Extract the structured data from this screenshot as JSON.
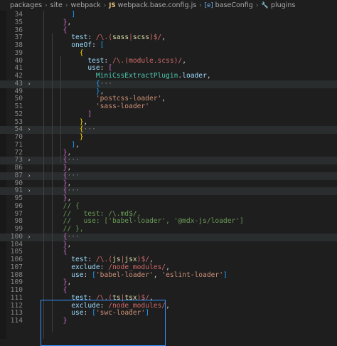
{
  "breadcrumb": {
    "items": [
      "packages",
      "site",
      "webpack",
      "webpack.base.config.js",
      "baseConfig",
      "plugins"
    ],
    "icons": [
      "chevron-right",
      "js-file-icon",
      "symbol-variable-icon",
      "wrench-icon"
    ]
  },
  "editor": {
    "lines": [
      {
        "n": "34",
        "fold": "",
        "segs": [
          [
            "        ",
            ""
          ],
          [
            "]",
            "b3"
          ]
        ]
      },
      {
        "n": "35",
        "fold": "",
        "segs": [
          [
            "      ",
            ""
          ],
          [
            "}",
            "b2"
          ],
          [
            ",",
            ""
          ]
        ]
      },
      {
        "n": "36",
        "fold": "",
        "segs": [
          [
            "      ",
            ""
          ],
          [
            "{",
            "b2"
          ]
        ]
      },
      {
        "n": "37",
        "fold": "",
        "segs": [
          [
            "        ",
            ""
          ],
          [
            "test",
            "k"
          ],
          [
            ": ",
            ""
          ],
          [
            "/\\.(",
            "r"
          ],
          [
            "sass",
            "rc"
          ],
          [
            "|",
            "r"
          ],
          [
            "scss",
            "rc"
          ],
          [
            ")$/",
            "r"
          ],
          [
            ",",
            ""
          ]
        ]
      },
      {
        "n": "38",
        "fold": "",
        "segs": [
          [
            "        ",
            ""
          ],
          [
            "oneOf",
            "k"
          ],
          [
            ": ",
            ""
          ],
          [
            "[",
            "b3"
          ]
        ]
      },
      {
        "n": "39",
        "fold": "",
        "segs": [
          [
            "          ",
            ""
          ],
          [
            "{",
            "b1"
          ]
        ]
      },
      {
        "n": "40",
        "fold": "",
        "segs": [
          [
            "            ",
            ""
          ],
          [
            "test",
            "k"
          ],
          [
            ": ",
            ""
          ],
          [
            "/\\.(module.scss)/",
            "r"
          ],
          [
            ",",
            ""
          ]
        ]
      },
      {
        "n": "41",
        "fold": "",
        "segs": [
          [
            "            ",
            ""
          ],
          [
            "use",
            "k"
          ],
          [
            ": ",
            ""
          ],
          [
            "[",
            "b2"
          ]
        ]
      },
      {
        "n": "42",
        "fold": "",
        "segs": [
          [
            "              ",
            ""
          ],
          [
            "MiniCssExtractPlugin",
            "fn"
          ],
          [
            ".",
            ""
          ],
          [
            "loader",
            "k"
          ],
          [
            ",",
            ""
          ]
        ]
      },
      {
        "n": "43",
        "fold": ">",
        "hl": true,
        "segs": [
          [
            "              ",
            ""
          ],
          [
            "{",
            "b3"
          ],
          [
            "···",
            "ell"
          ]
        ]
      },
      {
        "n": "49",
        "fold": "",
        "segs": [
          [
            "              ",
            ""
          ],
          [
            "}",
            "b3"
          ],
          [
            ",",
            ""
          ]
        ]
      },
      {
        "n": "50",
        "fold": "",
        "segs": [
          [
            "              ",
            ""
          ],
          [
            "'postcss-loader'",
            "s"
          ],
          [
            ",",
            ""
          ]
        ]
      },
      {
        "n": "51",
        "fold": "",
        "segs": [
          [
            "              ",
            ""
          ],
          [
            "'sass-loader'",
            "s"
          ]
        ]
      },
      {
        "n": "52",
        "fold": "",
        "segs": [
          [
            "            ",
            ""
          ],
          [
            "]",
            "b2"
          ]
        ]
      },
      {
        "n": "53",
        "fold": "",
        "segs": [
          [
            "          ",
            ""
          ],
          [
            "}",
            "b1"
          ],
          [
            ",",
            ""
          ]
        ]
      },
      {
        "n": "54",
        "fold": ">",
        "hl": true,
        "segs": [
          [
            "          ",
            ""
          ],
          [
            "{",
            "b1"
          ],
          [
            "···",
            "ell"
          ]
        ]
      },
      {
        "n": "70",
        "fold": "",
        "segs": [
          [
            "          ",
            ""
          ],
          [
            "}",
            "b1"
          ]
        ]
      },
      {
        "n": "71",
        "fold": "",
        "segs": [
          [
            "        ",
            ""
          ],
          [
            "]",
            "b3"
          ],
          [
            ",",
            ""
          ]
        ]
      },
      {
        "n": "72",
        "fold": "",
        "segs": [
          [
            "      ",
            ""
          ],
          [
            "}",
            "b2"
          ],
          [
            ",",
            ""
          ]
        ]
      },
      {
        "n": "73",
        "fold": ">",
        "hl": true,
        "segs": [
          [
            "      ",
            ""
          ],
          [
            "{",
            "b2"
          ],
          [
            "···",
            "ell"
          ]
        ]
      },
      {
        "n": "86",
        "fold": "",
        "segs": [
          [
            "      ",
            ""
          ],
          [
            "}",
            "b2"
          ],
          [
            ",",
            ""
          ]
        ]
      },
      {
        "n": "87",
        "fold": ">",
        "hl": true,
        "segs": [
          [
            "      ",
            ""
          ],
          [
            "{",
            "b2"
          ],
          [
            "···",
            "ell"
          ]
        ]
      },
      {
        "n": "90",
        "fold": "",
        "segs": [
          [
            "      ",
            ""
          ],
          [
            "}",
            "b2"
          ],
          [
            ",",
            ""
          ]
        ]
      },
      {
        "n": "91",
        "fold": ">",
        "hl": true,
        "segs": [
          [
            "      ",
            ""
          ],
          [
            "{",
            "b2"
          ],
          [
            "···",
            "ell"
          ]
        ]
      },
      {
        "n": "95",
        "fold": "",
        "segs": [
          [
            "      ",
            ""
          ],
          [
            "}",
            "b2"
          ],
          [
            ",",
            ""
          ]
        ]
      },
      {
        "n": "96",
        "fold": "",
        "segs": [
          [
            "      ",
            ""
          ],
          [
            "// {",
            "cm"
          ]
        ]
      },
      {
        "n": "97",
        "fold": "",
        "segs": [
          [
            "      ",
            ""
          ],
          [
            "//   test: /\\.md$/,",
            "cm"
          ]
        ]
      },
      {
        "n": "98",
        "fold": "",
        "segs": [
          [
            "      ",
            ""
          ],
          [
            "//   use: ['babel-loader', '@mdx-js/loader']",
            "cm"
          ]
        ]
      },
      {
        "n": "99",
        "fold": "",
        "segs": [
          [
            "      ",
            ""
          ],
          [
            "// },",
            "cm"
          ]
        ]
      },
      {
        "n": "100",
        "fold": ">",
        "hl": true,
        "segs": [
          [
            "      ",
            ""
          ],
          [
            "{",
            "b2"
          ],
          [
            "···",
            "ell"
          ]
        ]
      },
      {
        "n": "104",
        "fold": "",
        "segs": [
          [
            "      ",
            ""
          ],
          [
            "}",
            "b2"
          ],
          [
            ",",
            ""
          ]
        ]
      },
      {
        "n": "105",
        "fold": "",
        "segs": [
          [
            "      ",
            ""
          ],
          [
            "{",
            "b2"
          ]
        ]
      },
      {
        "n": "106",
        "fold": "",
        "segs": [
          [
            "        ",
            ""
          ],
          [
            "test",
            "k"
          ],
          [
            ": ",
            ""
          ],
          [
            "/\\.(",
            "r"
          ],
          [
            "js",
            "rc"
          ],
          [
            "|",
            "r"
          ],
          [
            "jsx",
            "rc"
          ],
          [
            ")$/",
            "r"
          ],
          [
            ",",
            ""
          ]
        ]
      },
      {
        "n": "107",
        "fold": "",
        "segs": [
          [
            "        ",
            ""
          ],
          [
            "exclude",
            "k"
          ],
          [
            ": ",
            ""
          ],
          [
            "/node_modules/",
            "r"
          ],
          [
            ",",
            ""
          ]
        ]
      },
      {
        "n": "108",
        "fold": "",
        "segs": [
          [
            "        ",
            ""
          ],
          [
            "use",
            "k"
          ],
          [
            ": ",
            ""
          ],
          [
            "[",
            "b3"
          ],
          [
            "'babel-loader'",
            "s"
          ],
          [
            ", ",
            ""
          ],
          [
            "'eslint-loader'",
            "s"
          ],
          [
            "]",
            "b3"
          ]
        ]
      },
      {
        "n": "109",
        "fold": "",
        "segs": [
          [
            "      ",
            ""
          ],
          [
            "}",
            "b2"
          ],
          [
            ",",
            ""
          ]
        ]
      },
      {
        "n": "110",
        "fold": "",
        "segs": [
          [
            "      ",
            ""
          ],
          [
            "{",
            "b2"
          ]
        ]
      },
      {
        "n": "111",
        "fold": "",
        "segs": [
          [
            "        ",
            ""
          ],
          [
            "test",
            "k"
          ],
          [
            ": ",
            ""
          ],
          [
            "/\\.(",
            "r"
          ],
          [
            "ts",
            "rc"
          ],
          [
            "|",
            "r"
          ],
          [
            "tsx",
            "rc"
          ],
          [
            ")$/",
            "r"
          ],
          [
            ",",
            ""
          ]
        ]
      },
      {
        "n": "112",
        "fold": "",
        "segs": [
          [
            "        ",
            ""
          ],
          [
            "exclude",
            "k"
          ],
          [
            ": ",
            ""
          ],
          [
            "/node_modules/",
            "r"
          ],
          [
            ",",
            ""
          ]
        ]
      },
      {
        "n": "113",
        "fold": "",
        "segs": [
          [
            "        ",
            ""
          ],
          [
            "use",
            "k"
          ],
          [
            ": ",
            ""
          ],
          [
            "[",
            "b3"
          ],
          [
            "'swc-loader'",
            "s"
          ],
          [
            "]",
            "b3"
          ]
        ]
      },
      {
        "n": "114",
        "fold": "",
        "segs": [
          [
            "      ",
            ""
          ],
          [
            "}",
            "b2"
          ]
        ]
      }
    ]
  },
  "colors": {
    "background": "#1e1e1e",
    "selection_border": "#3794ff",
    "folded_line": "#2a2d2e"
  }
}
